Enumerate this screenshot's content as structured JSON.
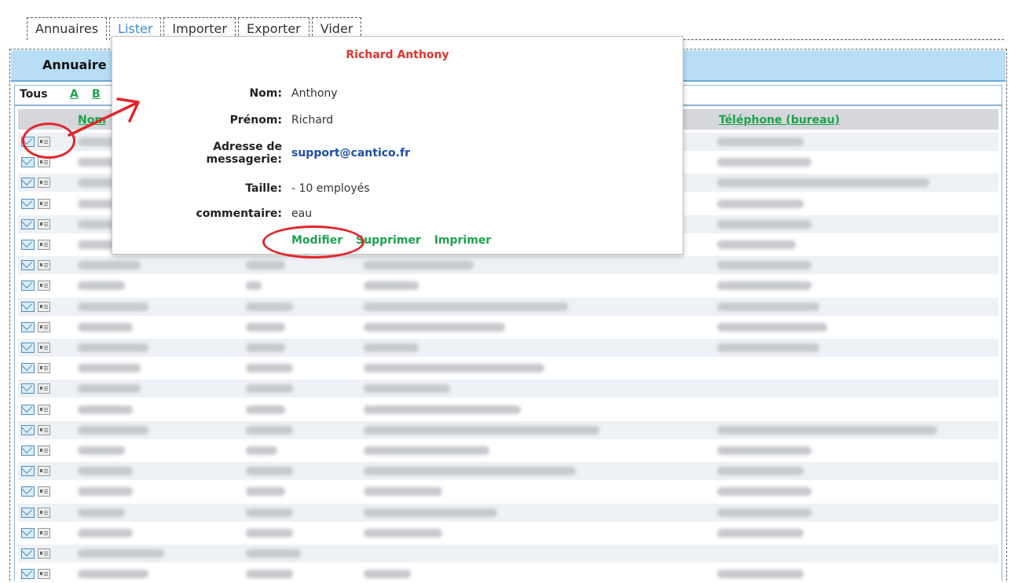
{
  "tabs": [
    {
      "label": "Annuaires"
    },
    {
      "label": "Lister"
    },
    {
      "label": "Importer"
    },
    {
      "label": "Exporter"
    },
    {
      "label": "Vider"
    }
  ],
  "title_bar": {
    "label": "Annuaire"
  },
  "letters": {
    "all": "Tous",
    "a": "A",
    "b": "B"
  },
  "table": {
    "col_name": "Nom",
    "col_phone": "Téléphone (bureau)"
  },
  "popup": {
    "title": "Richard Anthony",
    "nom_label": "Nom:",
    "nom_value": "Anthony",
    "prenom_label": "Prénom:",
    "prenom_value": "Richard",
    "email_label_1": "Adresse de",
    "email_label_2": "messagerie:",
    "email_value": "support@cantico.fr",
    "taille_label": "Taille:",
    "taille_value": "- 10 employés",
    "comment_label": "commentaire:",
    "comment_value": "eau",
    "modifier": "Modifier",
    "supprimer": "Supprimer",
    "imprimer": "Imprimer"
  },
  "colors": {
    "accent_green": "#1aa34a",
    "title_red": "#e0342c",
    "header_blue": "#b7ddf7",
    "annotation_red": "#e3262b"
  }
}
